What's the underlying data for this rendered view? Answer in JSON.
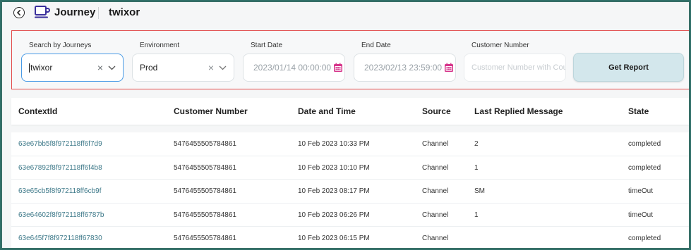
{
  "header": {
    "title": "Journey",
    "subtitle": "twixor"
  },
  "filters": {
    "journey": {
      "label": "Search by Journeys",
      "value": "twixor"
    },
    "environment": {
      "label": "Environment",
      "value": "Prod"
    },
    "start_date": {
      "label": "Start Date",
      "value": "2023/01/14 00:00:00"
    },
    "end_date": {
      "label": "End Date",
      "value": "2023/02/13 23:59:00"
    },
    "customer_number": {
      "label": "Customer Number",
      "placeholder": "Customer Number with Country"
    },
    "get_report_label": "Get Report"
  },
  "table": {
    "columns": [
      "ContextId",
      "Customer Number",
      "Date and Time",
      "Source",
      "Last Replied Message",
      "State"
    ],
    "rows": [
      {
        "context_id": "63e67bb5f8f972118ff6f7d9",
        "customer_number": "5476455505784861",
        "date_time": "10 Feb 2023 10:33 PM",
        "source": "Channel",
        "last_replied": "2",
        "state": "completed"
      },
      {
        "context_id": "63e67892f8f972118ff6f4b8",
        "customer_number": "5476455505784861",
        "date_time": "10 Feb 2023 10:10 PM",
        "source": "Channel",
        "last_replied": "1",
        "state": "completed"
      },
      {
        "context_id": "63e65cb5f8f972118ff6cb9f",
        "customer_number": "5476455505784861",
        "date_time": "10 Feb 2023 08:17 PM",
        "source": "Channel",
        "last_replied": "SM",
        "state": "timeOut"
      },
      {
        "context_id": "63e64602f8f972118ff6787b",
        "customer_number": "5476455505784861",
        "date_time": "10 Feb 2023 06:26 PM",
        "source": "Channel",
        "last_replied": "1",
        "state": "timeOut"
      },
      {
        "context_id": "63e645f7f8f972118ff67830",
        "customer_number": "5476455505784861",
        "date_time": "10 Feb 2023 06:15 PM",
        "source": "Channel",
        "last_replied": "",
        "state": "completed"
      }
    ]
  },
  "colors": {
    "accent_border": "#e24a4a",
    "active_input": "#4a9be6",
    "button_bg": "#d3e7ec",
    "calendar_icon": "#d6338a",
    "link": "#3f7a8a"
  },
  "icons": {
    "back": "back-arrow-circle-icon",
    "journey": "journey-cup-icon",
    "clear": "close-icon",
    "dropdown": "chevron-down-icon",
    "calendar": "calendar-icon"
  }
}
